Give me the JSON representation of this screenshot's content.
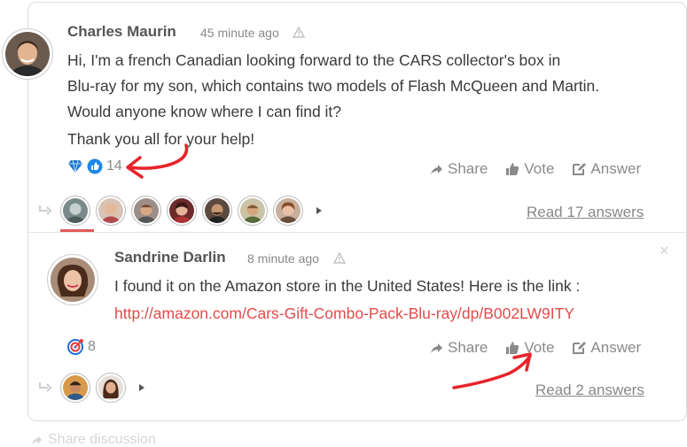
{
  "post": {
    "author": "Charles Maurin",
    "time": "45 minute ago",
    "lines": [
      "Hi, I'm a french Canadian looking forward to the CARS collector's box in",
      "Blu-ray for my son, which contains two models of Flash McQueen and Martin.",
      "Would anyone know where I can find it?",
      "Thank you all for your help!"
    ],
    "reaction_count": "14",
    "share_label": "Share",
    "vote_label": "Vote",
    "answer_label": "Answer",
    "read_answers": "Read 17 answers"
  },
  "reply": {
    "author": "Sandrine Darlin",
    "time": "8 minute ago",
    "text": "I found it on the Amazon store in the United States! Here is the link :",
    "link": "http://amazon.com/Cars-Gift-Combo-Pack-Blu-ray/dp/B002LW9ITY",
    "reaction_count": "8",
    "share_label": "Share",
    "vote_label": "Vote",
    "answer_label": "Answer",
    "read_answers": "Read 2 answers",
    "close": "×"
  },
  "footer": {
    "share_discussion": "Share discussion"
  },
  "colors": {
    "accent": "#e24b4b",
    "annotation": "#e8232a",
    "like_blue": "#1e88e5",
    "diamond_blue": "#1976d2"
  }
}
